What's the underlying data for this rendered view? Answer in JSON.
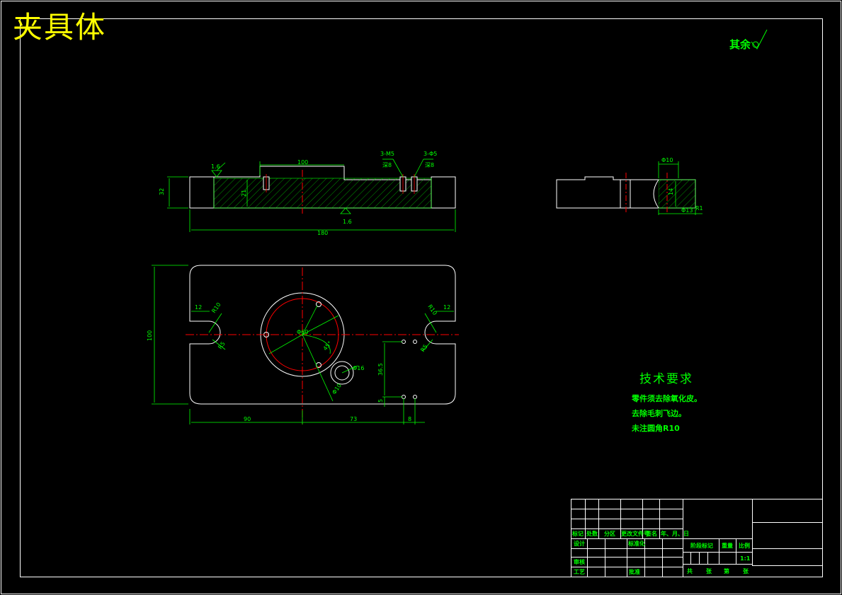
{
  "title": "夹具体",
  "roughness_note": "其余",
  "technical_requirements": {
    "heading": "技术要求",
    "items": [
      "零件须去除氧化皮。",
      "去除毛刺飞边。",
      "未注圆角R10"
    ]
  },
  "dimensions": {
    "front_len_180": "180",
    "front_h_32": "32",
    "front_h_21": "21",
    "front_w_100": "100",
    "roughness_1_6": "1.6",
    "note_3m5": "3-M5",
    "note_3m5_depth": "深8",
    "note_3phi5": "3-Φ5",
    "note_3phi5_depth": "深8",
    "side_w10": "Φ10",
    "side_h14": "14",
    "side_phi13": "Φ13",
    "side_r1": "R1",
    "plan_h_100": "100",
    "plan_12_left": "12",
    "plan_12_right": "12",
    "plan_r10_left": "R10",
    "plan_r10_right": "R10",
    "plan_r5_left": "R5",
    "plan_r5_right": "R5",
    "plan_phi60": "Φ60",
    "plan_45": "45°",
    "plan_phi16": "Φ16",
    "plan_phi10": "Φ10",
    "plan_h_36": "36.5",
    "plan_h_5": "5",
    "plan_90": "90",
    "plan_73": "73",
    "plan_8": "8"
  },
  "title_block": {
    "header": [
      "标记",
      "处数",
      "分区",
      "更改文件号",
      "签名",
      "年、月、日"
    ],
    "design": "设计",
    "standard": "标准化",
    "stage_mark": "阶段标记",
    "weight": "重量",
    "scale": "比例",
    "scale_value": "1:1",
    "review": "审核",
    "process": "工艺",
    "approve": "批准",
    "sheets": [
      "共",
      "张",
      "第",
      "张"
    ]
  },
  "colors": {
    "outline": "#ffffff",
    "dimension": "#00ff00",
    "centerline": "#ff0000",
    "title": "#ffff00",
    "background": "#000000"
  }
}
